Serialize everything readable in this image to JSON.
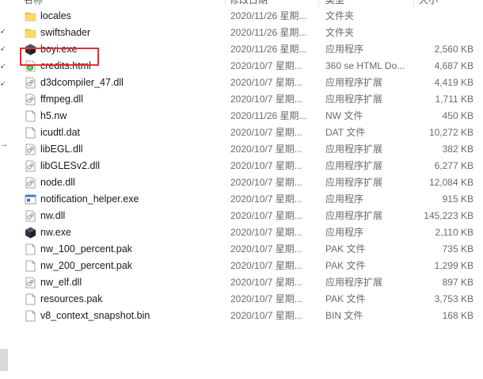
{
  "header": {
    "name": "名称",
    "date": "修改日期",
    "type": "类型",
    "size": "大小"
  },
  "files": [
    {
      "name": "locales",
      "date": "2020/11/26 星期...",
      "type": "文件夹",
      "size": "",
      "icon": "folder-icon"
    },
    {
      "name": "swiftshader",
      "date": "2020/11/26 星期...",
      "type": "文件夹",
      "size": "",
      "icon": "folder-icon"
    },
    {
      "name": "boyi.exe",
      "date": "2020/11/26 星期...",
      "type": "应用程序",
      "size": "2,560 KB",
      "icon": "app-cube-icon"
    },
    {
      "name": "credits.html",
      "date": "2020/10/7 星期...",
      "type": "360 se HTML Do...",
      "size": "4,687 KB",
      "icon": "browser-html-icon"
    },
    {
      "name": "d3dcompiler_47.dll",
      "date": "2020/10/7 星期...",
      "type": "应用程序扩展",
      "size": "4,419 KB",
      "icon": "dll-file-icon"
    },
    {
      "name": "ffmpeg.dll",
      "date": "2020/10/7 星期...",
      "type": "应用程序扩展",
      "size": "1,711 KB",
      "icon": "dll-file-icon"
    },
    {
      "name": "h5.nw",
      "date": "2020/11/26 星期...",
      "type": "NW 文件",
      "size": "450 KB",
      "icon": "blank-file-icon"
    },
    {
      "name": "icudtl.dat",
      "date": "2020/10/7 星期...",
      "type": "DAT 文件",
      "size": "10,272 KB",
      "icon": "blank-file-icon"
    },
    {
      "name": "libEGL.dll",
      "date": "2020/10/7 星期...",
      "type": "应用程序扩展",
      "size": "382 KB",
      "icon": "dll-file-icon"
    },
    {
      "name": "libGLESv2.dll",
      "date": "2020/10/7 星期...",
      "type": "应用程序扩展",
      "size": "6,277 KB",
      "icon": "dll-file-icon"
    },
    {
      "name": "node.dll",
      "date": "2020/10/7 星期...",
      "type": "应用程序扩展",
      "size": "12,084 KB",
      "icon": "dll-file-icon"
    },
    {
      "name": "notification_helper.exe",
      "date": "2020/10/7 星期...",
      "type": "应用程序",
      "size": "915 KB",
      "icon": "exe-window-icon"
    },
    {
      "name": "nw.dll",
      "date": "2020/10/7 星期...",
      "type": "应用程序扩展",
      "size": "145,223 KB",
      "icon": "dll-file-icon"
    },
    {
      "name": "nw.exe",
      "date": "2020/10/7 星期...",
      "type": "应用程序",
      "size": "2,110 KB",
      "icon": "app-cube-icon"
    },
    {
      "name": "nw_100_percent.pak",
      "date": "2020/10/7 星期...",
      "type": "PAK 文件",
      "size": "735 KB",
      "icon": "blank-file-icon"
    },
    {
      "name": "nw_200_percent.pak",
      "date": "2020/10/7 星期...",
      "type": "PAK 文件",
      "size": "1,299 KB",
      "icon": "blank-file-icon"
    },
    {
      "name": "nw_elf.dll",
      "date": "2020/10/7 星期...",
      "type": "应用程序扩展",
      "size": "897 KB",
      "icon": "dll-file-icon"
    },
    {
      "name": "resources.pak",
      "date": "2020/10/7 星期...",
      "type": "PAK 文件",
      "size": "3,753 KB",
      "icon": "blank-file-icon"
    },
    {
      "name": "v8_context_snapshot.bin",
      "date": "2020/10/7 星期...",
      "type": "BIN 文件",
      "size": "168 KB",
      "icon": "blank-file-icon"
    }
  ],
  "colors": {
    "highlight": "#e0312f",
    "folder": "#f4c542",
    "cube": "#2b3340"
  }
}
